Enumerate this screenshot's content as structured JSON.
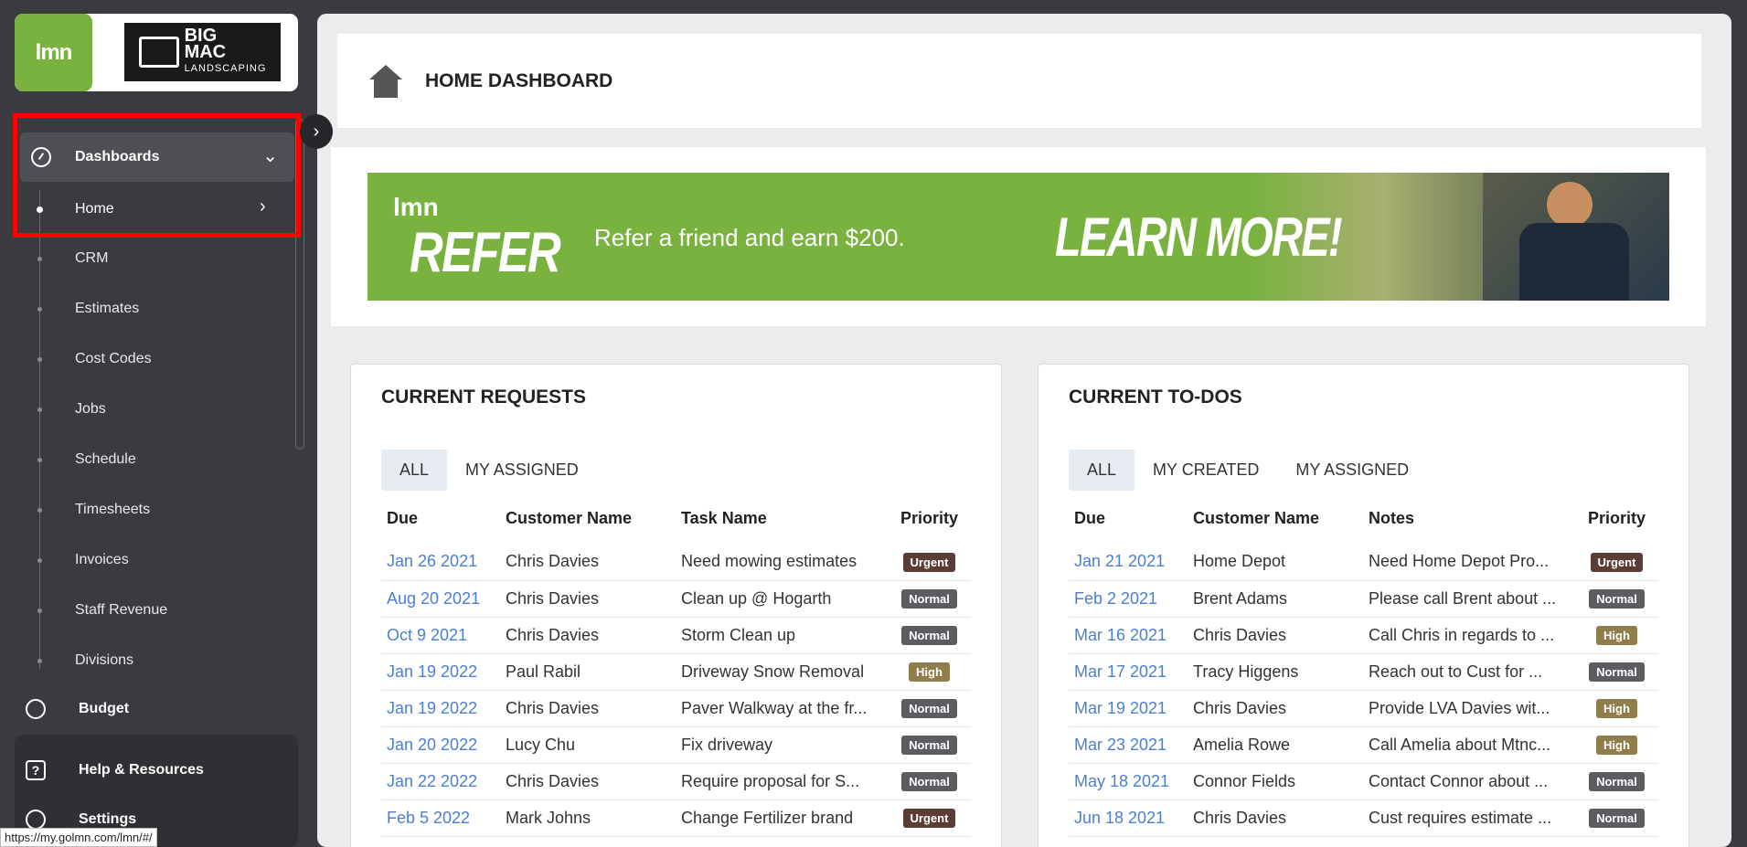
{
  "sidebar": {
    "logo_text": "lmn",
    "company_name_line1": "BIG",
    "company_name_line2": "MAC",
    "company_name_line3": "LANDSCAPING",
    "group_label": "Dashboards",
    "items": [
      {
        "label": "Home"
      },
      {
        "label": "CRM"
      },
      {
        "label": "Estimates"
      },
      {
        "label": "Cost Codes"
      },
      {
        "label": "Jobs"
      },
      {
        "label": "Schedule"
      },
      {
        "label": "Timesheets"
      },
      {
        "label": "Invoices"
      },
      {
        "label": "Staff Revenue"
      },
      {
        "label": "Divisions"
      }
    ],
    "budget_label": "Budget",
    "help_label": "Help & Resources",
    "settings_label": "Settings"
  },
  "status_url": "https://my.golmn.com/lmn/#/",
  "header": {
    "title": "HOME DASHBOARD"
  },
  "banner": {
    "logo": "lmn",
    "heading": "REFER",
    "tagline": "Refer a friend and earn $200.",
    "cta": "LEARN MORE!"
  },
  "requests": {
    "title": "CURRENT REQUESTS",
    "tabs": [
      "ALL",
      "MY ASSIGNED"
    ],
    "columns": [
      "Due",
      "Customer Name",
      "Task Name",
      "Priority"
    ],
    "rows": [
      {
        "due": "Jan 26 2021",
        "customer": "Chris Davies",
        "task": "Need mowing estimates",
        "priority": "Urgent"
      },
      {
        "due": "Aug 20 2021",
        "customer": "Chris Davies",
        "task": "Clean up @ Hogarth",
        "priority": "Normal"
      },
      {
        "due": "Oct 9 2021",
        "customer": "Chris Davies",
        "task": "Storm Clean up",
        "priority": "Normal"
      },
      {
        "due": "Jan 19 2022",
        "customer": "Paul Rabil",
        "task": "Driveway Snow Removal",
        "priority": "High"
      },
      {
        "due": "Jan 19 2022",
        "customer": "Chris Davies",
        "task": "Paver Walkway at the fr...",
        "priority": "Normal"
      },
      {
        "due": "Jan 20 2022",
        "customer": "Lucy Chu",
        "task": "Fix driveway",
        "priority": "Normal"
      },
      {
        "due": "Jan 22 2022",
        "customer": "Chris Davies",
        "task": "Require proposal for S...",
        "priority": "Normal"
      },
      {
        "due": "Feb 5 2022",
        "customer": "Mark Johns",
        "task": "Change Fertilizer brand",
        "priority": "Urgent"
      }
    ]
  },
  "todos": {
    "title": "CURRENT TO-DOS",
    "tabs": [
      "ALL",
      "MY CREATED",
      "MY ASSIGNED"
    ],
    "columns": [
      "Due",
      "Customer Name",
      "Notes",
      "Priority"
    ],
    "rows": [
      {
        "due": "Jan 21 2021",
        "customer": "Home Depot",
        "notes": "Need Home Depot Pro...",
        "priority": "Urgent"
      },
      {
        "due": "Feb 2 2021",
        "customer": "Brent Adams",
        "notes": "Please call Brent about ...",
        "priority": "Normal"
      },
      {
        "due": "Mar 16 2021",
        "customer": "Chris Davies",
        "notes": "Call Chris in regards to ...",
        "priority": "High"
      },
      {
        "due": "Mar 17 2021",
        "customer": "Tracy Higgens",
        "notes": "Reach out to Cust for ...",
        "priority": "Normal"
      },
      {
        "due": "Mar 19 2021",
        "customer": "Chris Davies",
        "notes": "Provide LVA Davies wit...",
        "priority": "High"
      },
      {
        "due": "Mar 23 2021",
        "customer": "Amelia Rowe",
        "notes": "Call Amelia about Mtnc...",
        "priority": "High"
      },
      {
        "due": "May 18 2021",
        "customer": "Connor Fields",
        "notes": "Contact Connor about ...",
        "priority": "Normal"
      },
      {
        "due": "Jun 18 2021",
        "customer": "Chris Davies",
        "notes": "Cust requires estimate ...",
        "priority": "Normal"
      }
    ]
  },
  "colors": {
    "brand_green": "#7ab240",
    "sidebar_bg": "#3a3b3f",
    "link_blue": "#4a7fd1",
    "urgent": "#5a3e35",
    "normal": "#5c5d61",
    "high": "#8f7e4c",
    "highlight_red": "#ff0000"
  }
}
